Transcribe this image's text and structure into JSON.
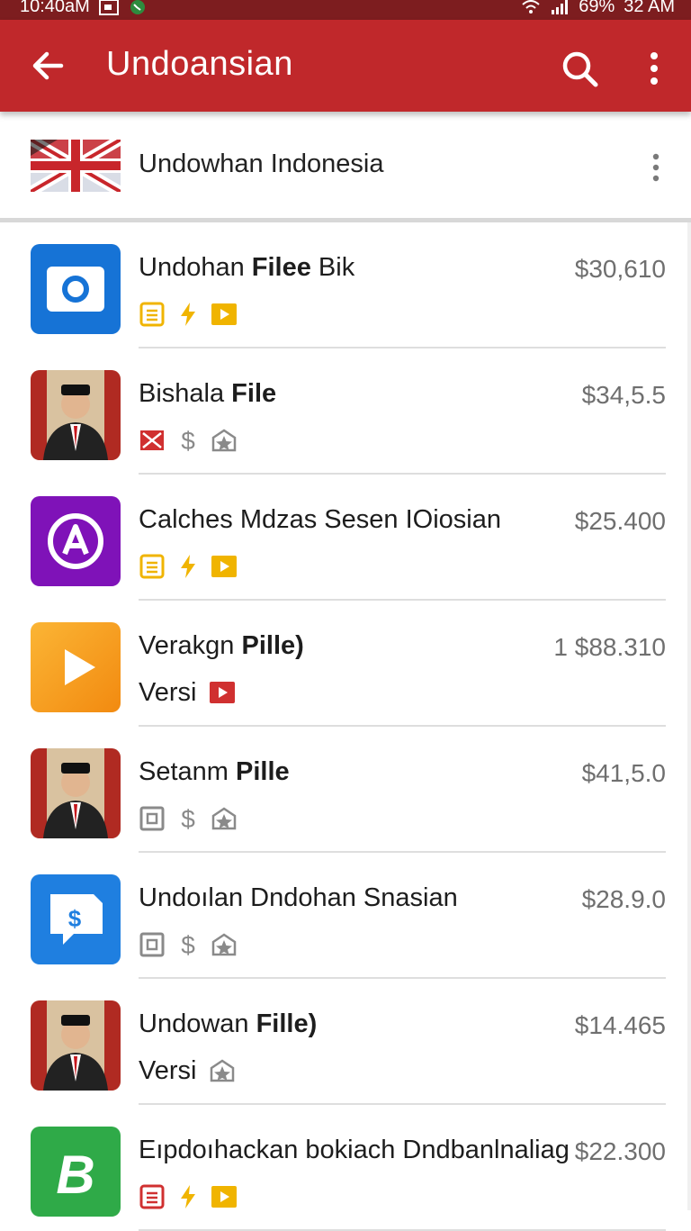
{
  "status_bar": {
    "time": "10:40aM",
    "battery": "69%",
    "right_time": "32 AM"
  },
  "app_bar": {
    "title": "Undoansian"
  },
  "subheader": {
    "label": "Undowhan Indonesia"
  },
  "items": [
    {
      "name_plain": "Undohan ",
      "name_bold": "Filee",
      "name_tail": " Bik",
      "price": "$30,610",
      "prefix": "",
      "icons": [
        "document-icon",
        "bolt-icon",
        "play-icon"
      ],
      "thumb": "camera-app"
    },
    {
      "name_plain": "Bishala ",
      "name_bold": "File",
      "name_tail": "",
      "price": "$34,5.5",
      "prefix": "",
      "icons": [
        "mail-icon",
        "dollar-icon",
        "star-badge-icon"
      ],
      "thumb": "person-portrait"
    },
    {
      "name_plain": "Calches Mdzas Sesen IOiosian",
      "name_bold": "",
      "name_tail": "",
      "price": "$25.400",
      "prefix": "",
      "icons": [
        "document-icon",
        "bolt-icon",
        "play-icon"
      ],
      "thumb": "a-app"
    },
    {
      "name_plain": "Verakgn ",
      "name_bold": "Pille)",
      "name_tail": "",
      "price": "1 $88.310",
      "prefix": "Versi",
      "icons": [
        "red-play-icon"
      ],
      "thumb": "play-app"
    },
    {
      "name_plain": "Setanm ",
      "name_bold": "Pille",
      "name_tail": "",
      "price": "$41,5.0",
      "prefix": "",
      "icons": [
        "frame-icon",
        "dollar-icon",
        "star-badge-icon"
      ],
      "thumb": "person-portrait"
    },
    {
      "name_plain": "Undoılan Dndohan Snasian",
      "name_bold": "",
      "name_tail": "",
      "price": "$28.9.0",
      "prefix": "",
      "icons": [
        "frame-icon",
        "dollar-icon",
        "star-badge-icon"
      ],
      "thumb": "dollar-app"
    },
    {
      "name_plain": "Undowan ",
      "name_bold": "Fille)",
      "name_tail": "",
      "price": "$14.465",
      "prefix": "Versi",
      "icons": [
        "star-badge-icon"
      ],
      "thumb": "person-portrait"
    },
    {
      "name_plain": "Eıpdoıhackan bokiach Dndbanlnaliag",
      "name_bold": "",
      "name_tail": "",
      "price": "$22.300",
      "prefix": "",
      "icons": [
        "document-red-icon",
        "bolt-icon",
        "play-icon"
      ],
      "thumb": "b-app"
    }
  ],
  "colors": {
    "appbar": "#c0282b",
    "statusbar": "#7d1d1f",
    "accent_yellow": "#f0b400",
    "accent_red": "#d03030"
  }
}
